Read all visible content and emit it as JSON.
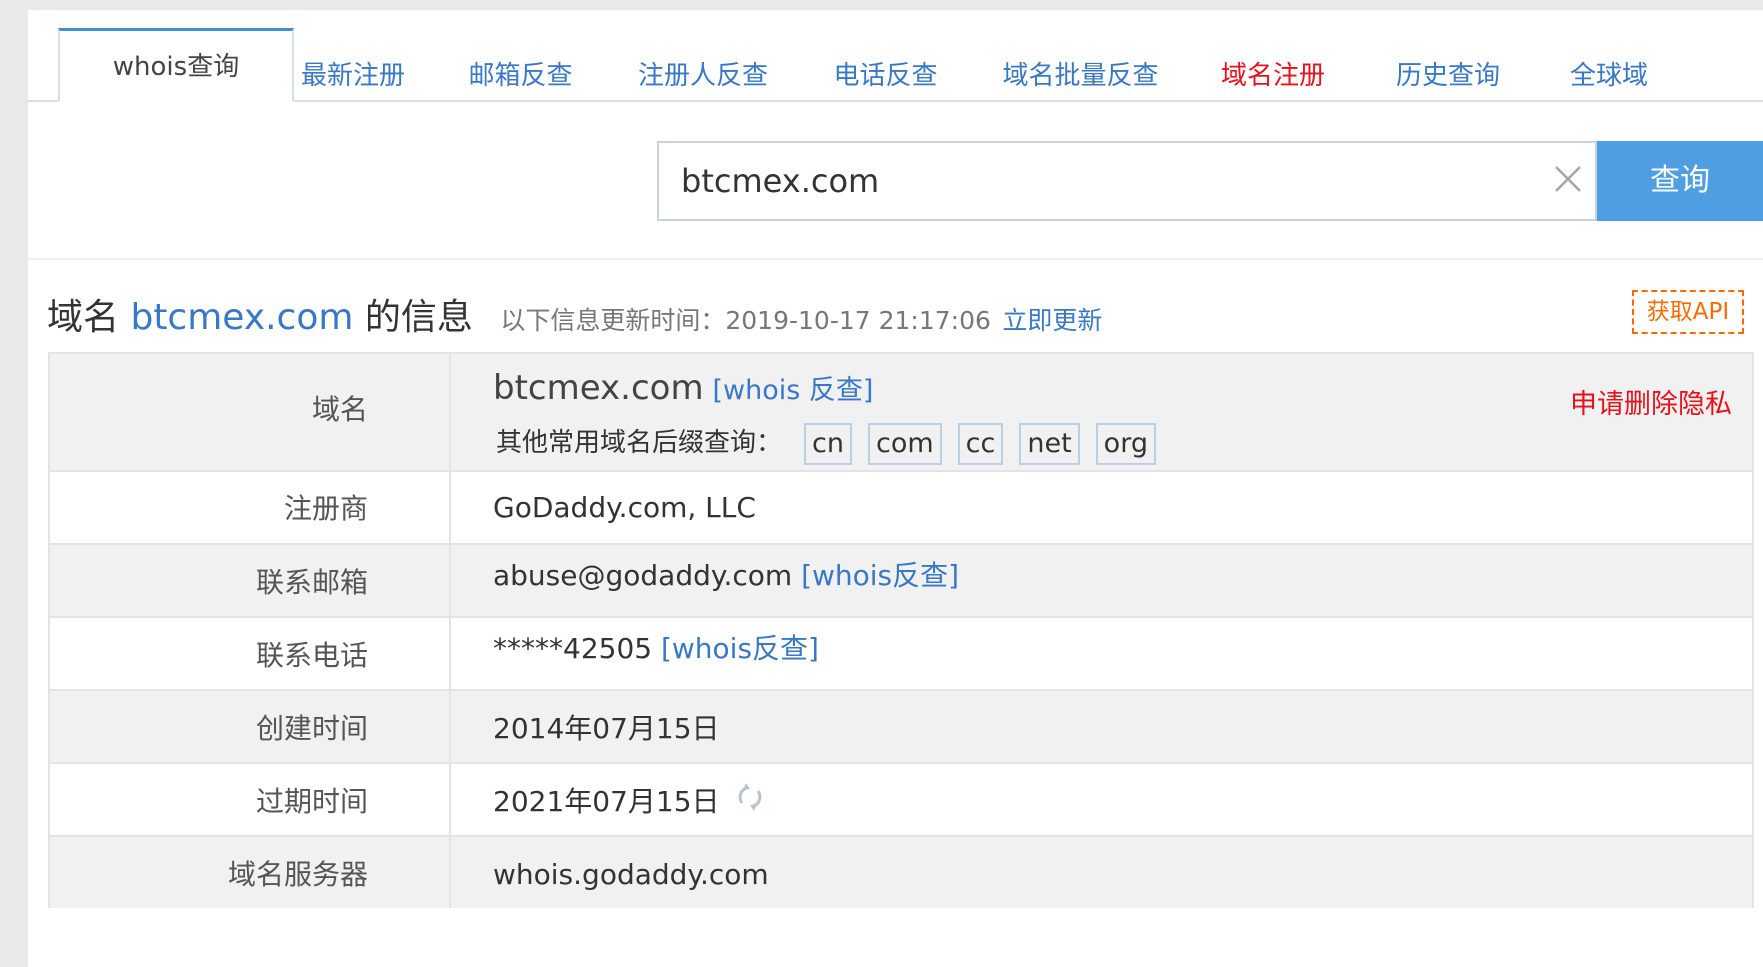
{
  "tabs": [
    {
      "label": "whois查询"
    },
    {
      "label": "最新注册"
    },
    {
      "label": "邮箱反查"
    },
    {
      "label": "注册人反查"
    },
    {
      "label": "电话反查"
    },
    {
      "label": "域名批量反查"
    },
    {
      "label": "域名注册"
    },
    {
      "label": "历史查询"
    },
    {
      "label": "全球域"
    }
  ],
  "search": {
    "value": "btcmex.com",
    "button_label": "查询"
  },
  "heading": {
    "prefix": "域名",
    "domain": "btcmex.com",
    "suffix": "的信息",
    "update_text": "以下信息更新时间：2019-10-17 21:17:06",
    "update_link": "立即更新",
    "api_label": "获取API"
  },
  "rows": {
    "domain": {
      "label": "域名",
      "value": "btcmex.com",
      "whois_link": "[whois 反查]",
      "privacy_link": "申请删除隐私",
      "suffix_prompt": "其他常用域名后缀查询：",
      "suffixes": [
        "cn",
        "com",
        "cc",
        "net",
        "org"
      ]
    },
    "registrar": {
      "label": "注册商",
      "value": "GoDaddy.com, LLC"
    },
    "email": {
      "label": "联系邮箱",
      "value": "abuse@godaddy.com",
      "link": "[whois反查]"
    },
    "phone": {
      "label": "联系电话",
      "value": "*****42505",
      "link": "[whois反查]"
    },
    "created": {
      "label": "创建时间",
      "value": "2014年07月15日"
    },
    "expires": {
      "label": "过期时间",
      "value": "2021年07月15日"
    },
    "nameserver": {
      "label": "域名服务器",
      "value": "whois.godaddy.com"
    }
  }
}
